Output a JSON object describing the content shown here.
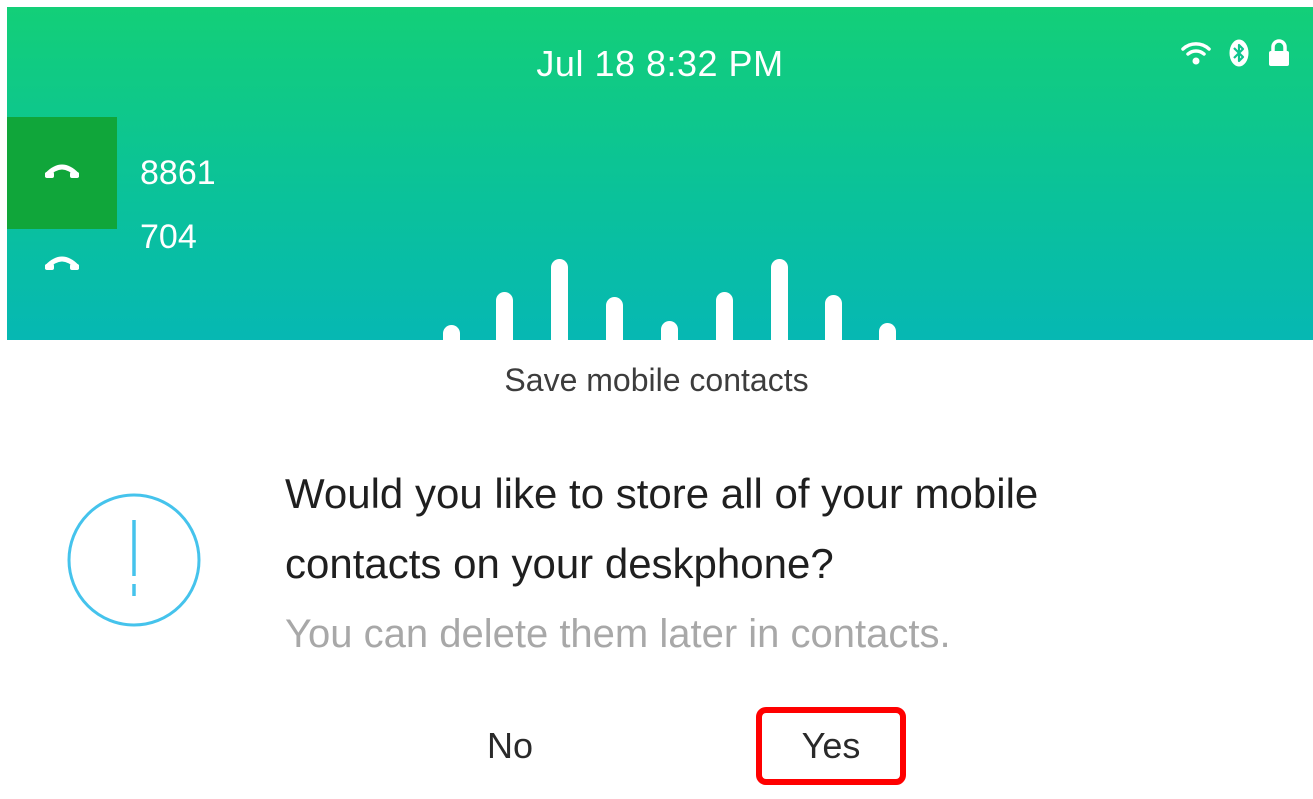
{
  "status_bar": {
    "datetime": "Jul 18 8:32 PM",
    "icons": [
      "wifi-icon",
      "bluetooth-icon",
      "lock-icon"
    ]
  },
  "lines": [
    {
      "label": "8861",
      "icon": "phone-handset-icon",
      "active": true
    },
    {
      "label": "704",
      "icon": "phone-handset-icon",
      "active": false
    }
  ],
  "dialog": {
    "title": "Save mobile contacts",
    "icon": "alert-icon",
    "message_line1": "Would you like to store all of your mobile",
    "message_line2": "contacts on your deskphone?",
    "submessage": "You can delete them later in contacts.",
    "buttons": {
      "no": "No",
      "yes": "Yes"
    }
  },
  "colors": {
    "header_top": "#13cf78",
    "header_bottom": "#06b8b3",
    "active_line": "#10a63a",
    "alert_icon": "#45c3ec",
    "highlight": "#ff0000"
  }
}
